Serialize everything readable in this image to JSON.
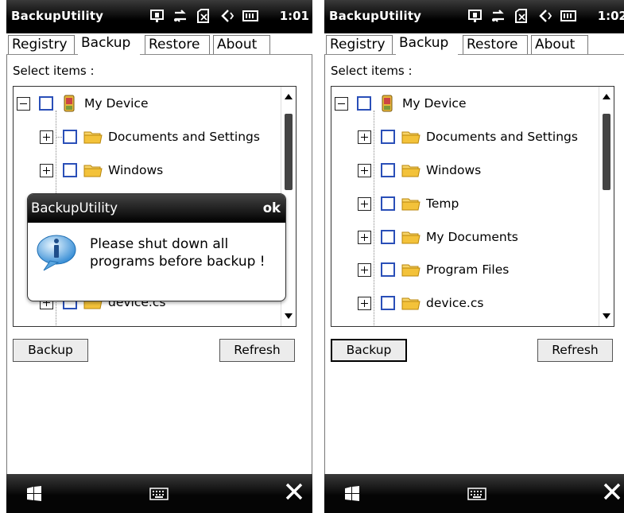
{
  "app_title": "BackupUtility",
  "tabs": [
    "Registry",
    "Backup",
    "Restore",
    "About"
  ],
  "select_label": "Select items :",
  "tree": {
    "root": "My Device",
    "children": [
      "Documents and Settings",
      "Windows",
      "Temp",
      "My Documents",
      "Program Files",
      "device.cs"
    ]
  },
  "buttons": {
    "backup": "Backup",
    "refresh": "Refresh"
  },
  "dialog": {
    "title": "BackupUtility",
    "ok": "ok",
    "message_line1": "Please shut down all",
    "message_line2": "programs before backup !"
  },
  "screens": [
    {
      "time": "1:01",
      "dialog_visible": true
    },
    {
      "time": "1:02",
      "dialog_visible": false
    }
  ],
  "icons": [
    "signal-icon",
    "data-connection-icon",
    "no-sim-icon",
    "volume-icon",
    "battery-icon",
    "windows-start-icon",
    "keyboard-icon",
    "close-icon",
    "info-icon",
    "folder-icon",
    "device-icon"
  ],
  "colors": {
    "checkbox_border": "#2a4fb8",
    "folder_yellow": "#f3c23a",
    "bar_dark": "#000000"
  }
}
